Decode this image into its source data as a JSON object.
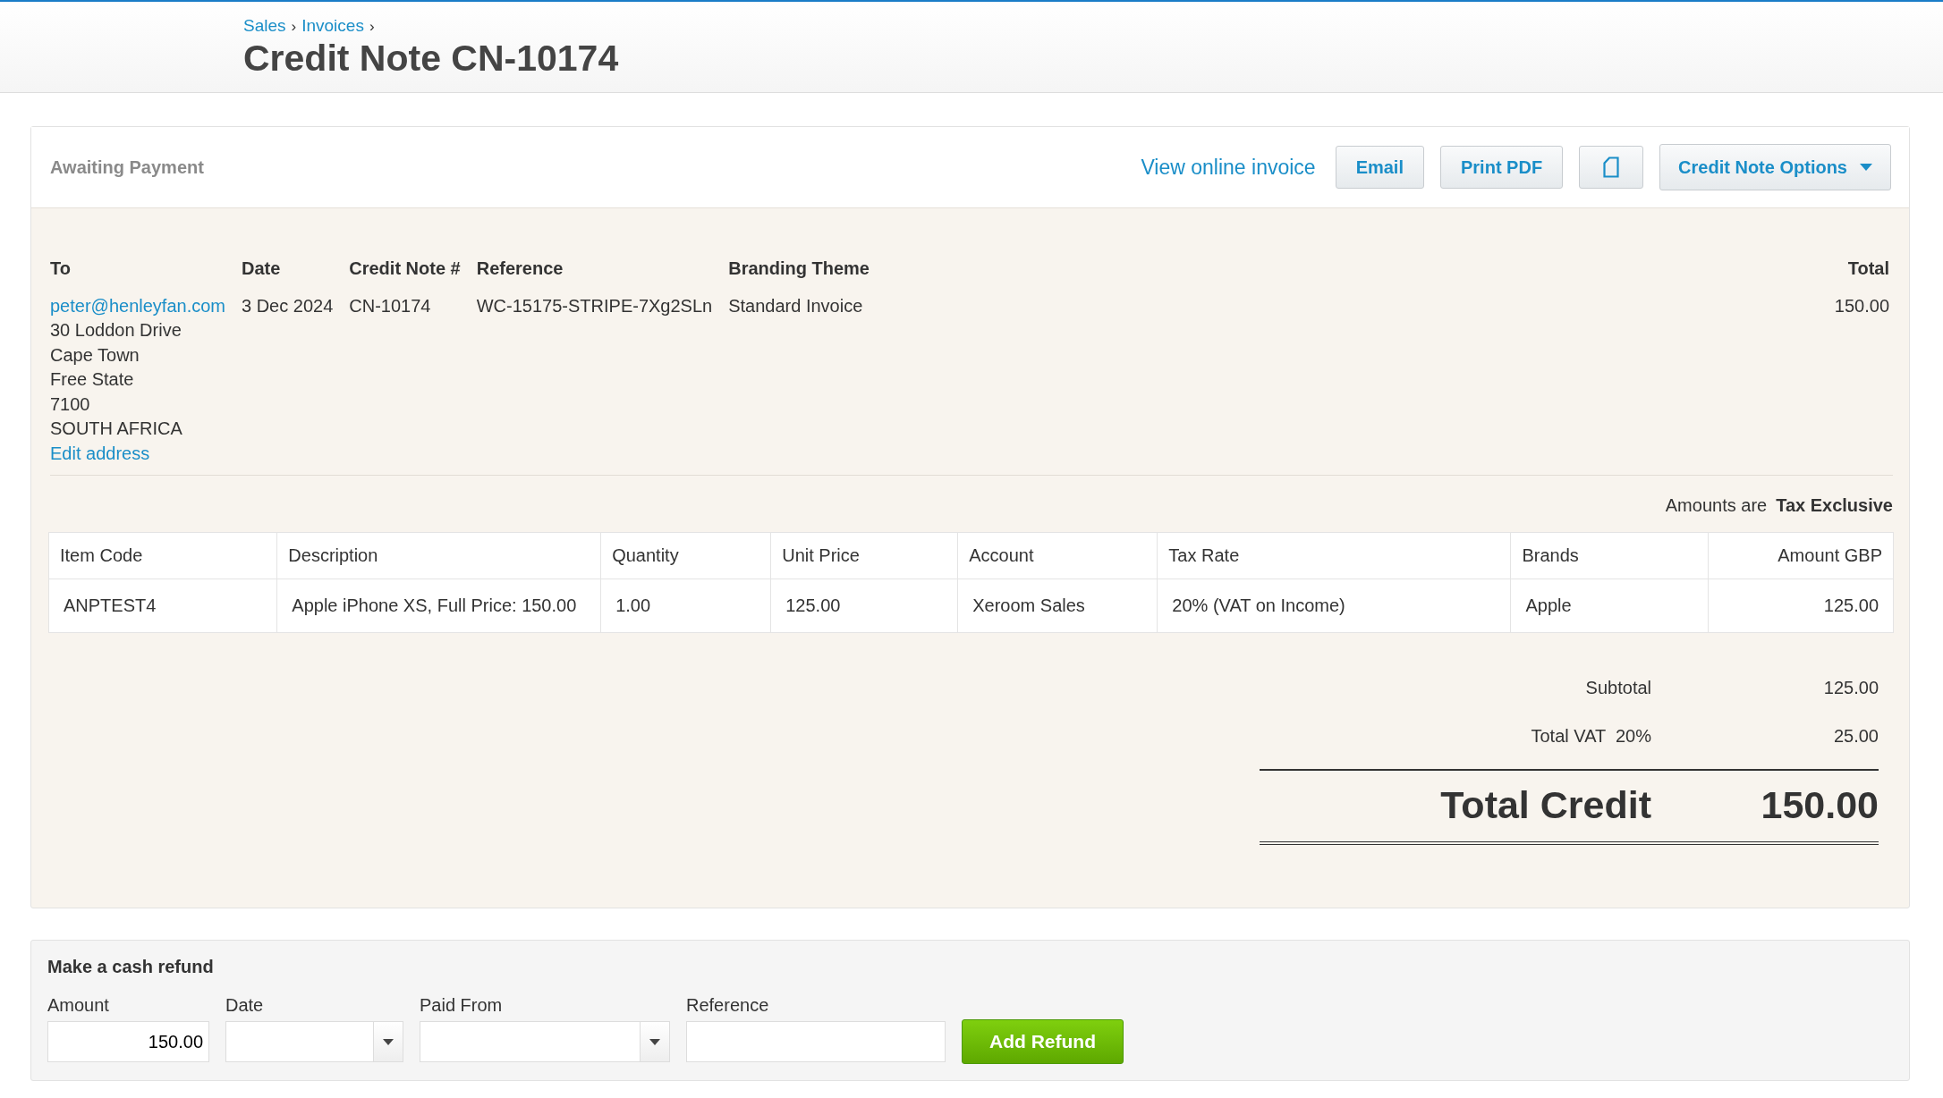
{
  "breadcrumb": [
    {
      "label": "Sales"
    },
    {
      "label": "Invoices"
    }
  ],
  "breadcrumb_separator": "›",
  "title": "Credit Note CN-10174",
  "status": "Awaiting Payment",
  "actions": {
    "view_link": "View online invoice",
    "buttons": [
      "Email",
      "Print PDF"
    ],
    "options_button": "Credit Note Options"
  },
  "details": {
    "columns": [
      {
        "heading": "To",
        "lines": [
          "30 Loddon Drive",
          "Cape Town",
          "Free State",
          "7100",
          "SOUTH AFRICA"
        ],
        "link": "peter@henleyfan.com",
        "edit_link": "Edit address"
      },
      {
        "heading": "Date",
        "value": "3 Dec 2024"
      },
      {
        "heading": "Credit Note #",
        "value": "CN-10174"
      },
      {
        "heading": "Reference",
        "value": "WC-15175-STRIPE-7Xg2SLn"
      },
      {
        "heading": "Branding Theme",
        "value": "Standard Invoice"
      }
    ],
    "total": {
      "heading": "Total",
      "value": "150.00"
    }
  },
  "amounts_note": {
    "label": "Amounts are",
    "value": "Tax Exclusive"
  },
  "table": {
    "columns": [
      "Item Code",
      "Description",
      "Quantity",
      "Unit Price",
      "Account",
      "Tax Rate",
      "Brands",
      "Amount GBP"
    ],
    "rows": [
      [
        "ANPTEST4",
        "Apple iPhone XS, Full Price: 150.00",
        "1.00",
        "125.00",
        "Xeroom Sales",
        "20% (VAT on Income)",
        "Apple",
        "125.00"
      ]
    ]
  },
  "totals": [
    {
      "label": "Subtotal",
      "value": "125.00"
    },
    {
      "label": "Total VAT  20%",
      "value": "25.00"
    }
  ],
  "grand_total": {
    "label": "Total Credit",
    "value": "150.00"
  },
  "refund": {
    "title": "Make a cash refund",
    "fields": [
      {
        "label": "Amount",
        "kind": "text",
        "value": "150.00"
      },
      {
        "label": "Date",
        "kind": "dropdown"
      },
      {
        "label": "Paid From",
        "kind": "dropdown"
      },
      {
        "label": "Reference",
        "kind": "text"
      }
    ],
    "button": "Add Refund"
  }
}
